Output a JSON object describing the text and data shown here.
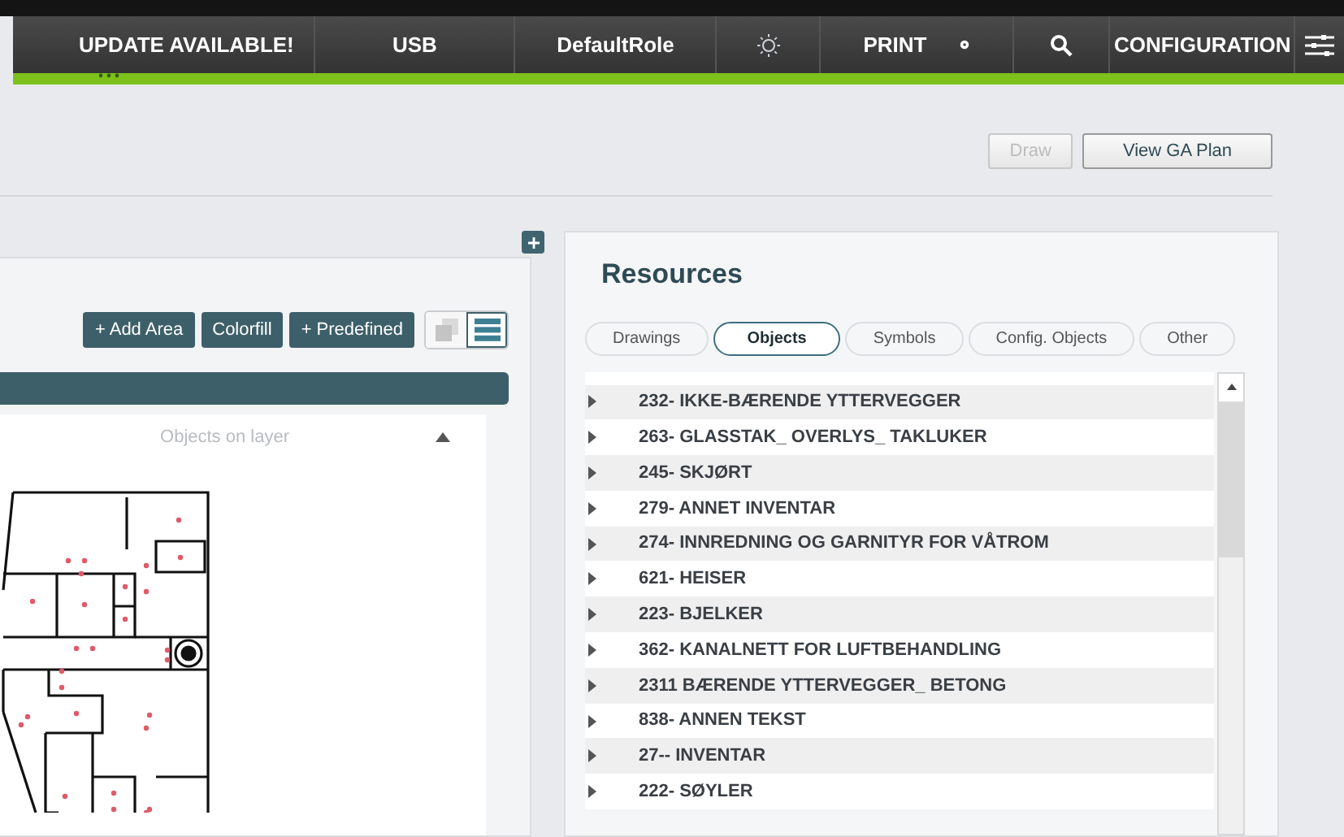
{
  "top_bar": {
    "items": [
      {
        "kind": "text",
        "label": "UPDATE AVAILABLE!"
      },
      {
        "kind": "text",
        "label": "USB"
      },
      {
        "kind": "text",
        "label": "DefaultRole"
      },
      {
        "kind": "sun"
      },
      {
        "kind": "print",
        "label": "PRINT"
      },
      {
        "kind": "search"
      },
      {
        "kind": "text",
        "label": "CONFIGURATION"
      },
      {
        "kind": "menu"
      }
    ]
  },
  "header_buttons": [
    {
      "label": "Draw",
      "disabled": true
    },
    {
      "label": "View GA Plan",
      "disabled": false
    }
  ],
  "layer_panel": {
    "buttons": [
      "+ Add Area",
      "Colorfill",
      "+ Predefined"
    ],
    "view_toggle": [
      {
        "kind": "cards",
        "selected": false
      },
      {
        "kind": "list",
        "selected": true
      }
    ],
    "objects_header": "Objects on layer"
  },
  "resources": {
    "title": "Resources",
    "tabs": [
      {
        "label": "Drawings",
        "selected": false
      },
      {
        "label": "Objects",
        "selected": true
      },
      {
        "label": "Symbols",
        "selected": false
      },
      {
        "label": "Config. Objects",
        "selected": false
      },
      {
        "label": "Other",
        "selected": false
      }
    ],
    "items": [
      "232- IKKE-BÆRENDE YTTERVEGGER",
      "263- GLASSTAK_ OVERLYS_ TAKLUKER",
      "245- SKJØRT",
      "279- ANNET INVENTAR",
      "274- INNREDNING OG GARNITYR FOR VÅTROM",
      "621- HEISER",
      "223- BJELKER",
      "362- KANALNETT FOR LUFTBEHANDLING",
      "2311 BÆRENDE YTTERVEGGER_ BETONG",
      "838- ANNEN TEKST",
      "27-- INVENTAR",
      "222- SØYLER"
    ]
  }
}
